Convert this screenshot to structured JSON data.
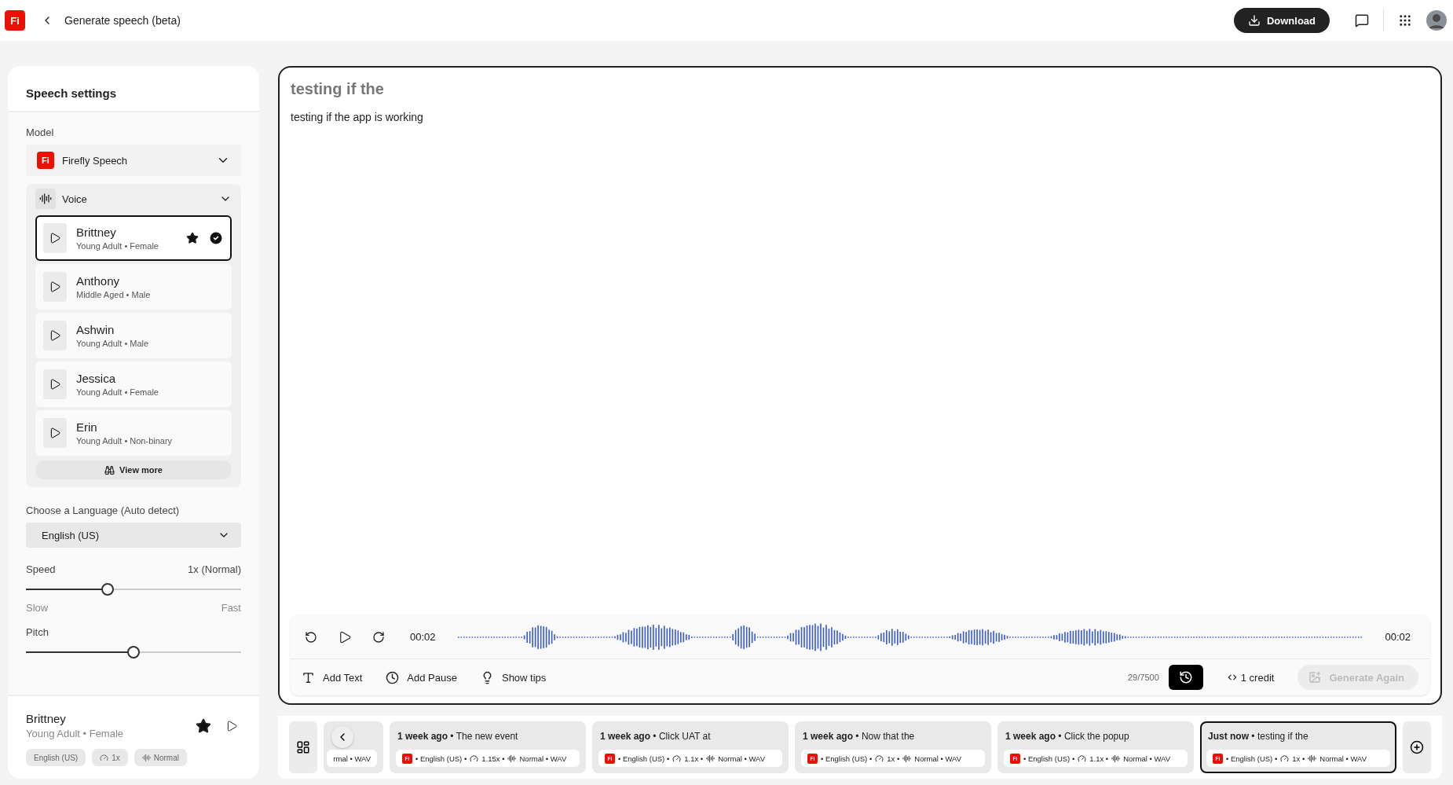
{
  "app": {
    "logo": "Fi",
    "back_label": "Generate speech (beta)",
    "download_label": "Download"
  },
  "settings": {
    "title": "Speech settings",
    "model_label": "Model",
    "model": {
      "badge": "Fi",
      "name": "Firefly Speech"
    },
    "voice_section": {
      "label": "Voice",
      "expanded": true
    },
    "voices": [
      {
        "name": "Brittney",
        "desc": "Young Adult • Female",
        "selected": true,
        "favorite": true
      },
      {
        "name": "Anthony",
        "desc": "Middle Aged • Male",
        "selected": false,
        "favorite": false
      },
      {
        "name": "Ashwin",
        "desc": "Young Adult • Male",
        "selected": false,
        "favorite": false
      },
      {
        "name": "Jessica",
        "desc": "Young Adult • Female",
        "selected": false,
        "favorite": false
      },
      {
        "name": "Erin",
        "desc": "Young Adult • Non-binary",
        "selected": false,
        "favorite": false
      }
    ],
    "view_more": "View more",
    "language_label": "Choose a Language (Auto detect)",
    "language": "English (US)",
    "speed": {
      "label": "Speed",
      "reading": "1x (Normal)",
      "level": 0.38,
      "min_label": "Slow",
      "max_label": "Fast"
    },
    "pitch": {
      "label": "Pitch",
      "level": 0.5
    },
    "summary": {
      "name": "Brittney",
      "desc": "Young Adult • Female",
      "favorite": true,
      "chips": [
        {
          "kind": "language",
          "text": "English (US)"
        },
        {
          "kind": "speed",
          "text": "1x"
        },
        {
          "kind": "pitch",
          "text": "Normal"
        }
      ]
    }
  },
  "editor": {
    "title": "testing if the",
    "text": "testing if the app is working",
    "player": {
      "current": "00:02",
      "total": "00:02"
    },
    "tools": [
      "Add Text",
      "Add Pause",
      "Show tips"
    ],
    "char_count": "29/7500",
    "credit": "1 credit",
    "generate": {
      "label": "Generate Again",
      "disabled": true
    }
  },
  "history": [
    {
      "kind": "partial",
      "meta_tail": "rmal • WAV",
      "selected": false
    },
    {
      "kind": "full",
      "title": "**1 week ago** • The new event",
      "badge": "Fi",
      "language": "• English (US) •",
      "speed": "1.15x •",
      "pitch": "Normal • WAV",
      "selected": false
    },
    {
      "kind": "full",
      "title": "**1 week ago** • Click UAT at",
      "badge": "Fi",
      "language": "• English (US) •",
      "speed": "1.1x •",
      "pitch": "Normal • WAV",
      "selected": false
    },
    {
      "kind": "full",
      "title": "**1 week ago** • Now that the",
      "badge": "Fi",
      "language": "• English (US) •",
      "speed": "1x •",
      "pitch": "Normal • WAV",
      "selected": false
    },
    {
      "kind": "full",
      "title": "**1 week ago** • Click the popup",
      "badge": "Fi",
      "language": "• English (US) •",
      "speed": "1.1x •",
      "pitch": "Normal • WAV",
      "selected": false
    },
    {
      "kind": "full",
      "title": "**Just now** • testing if the",
      "badge": "Fi",
      "language": "• English (US) •",
      "speed": "1x •",
      "pitch": "Normal • WAV",
      "selected": true
    }
  ]
}
